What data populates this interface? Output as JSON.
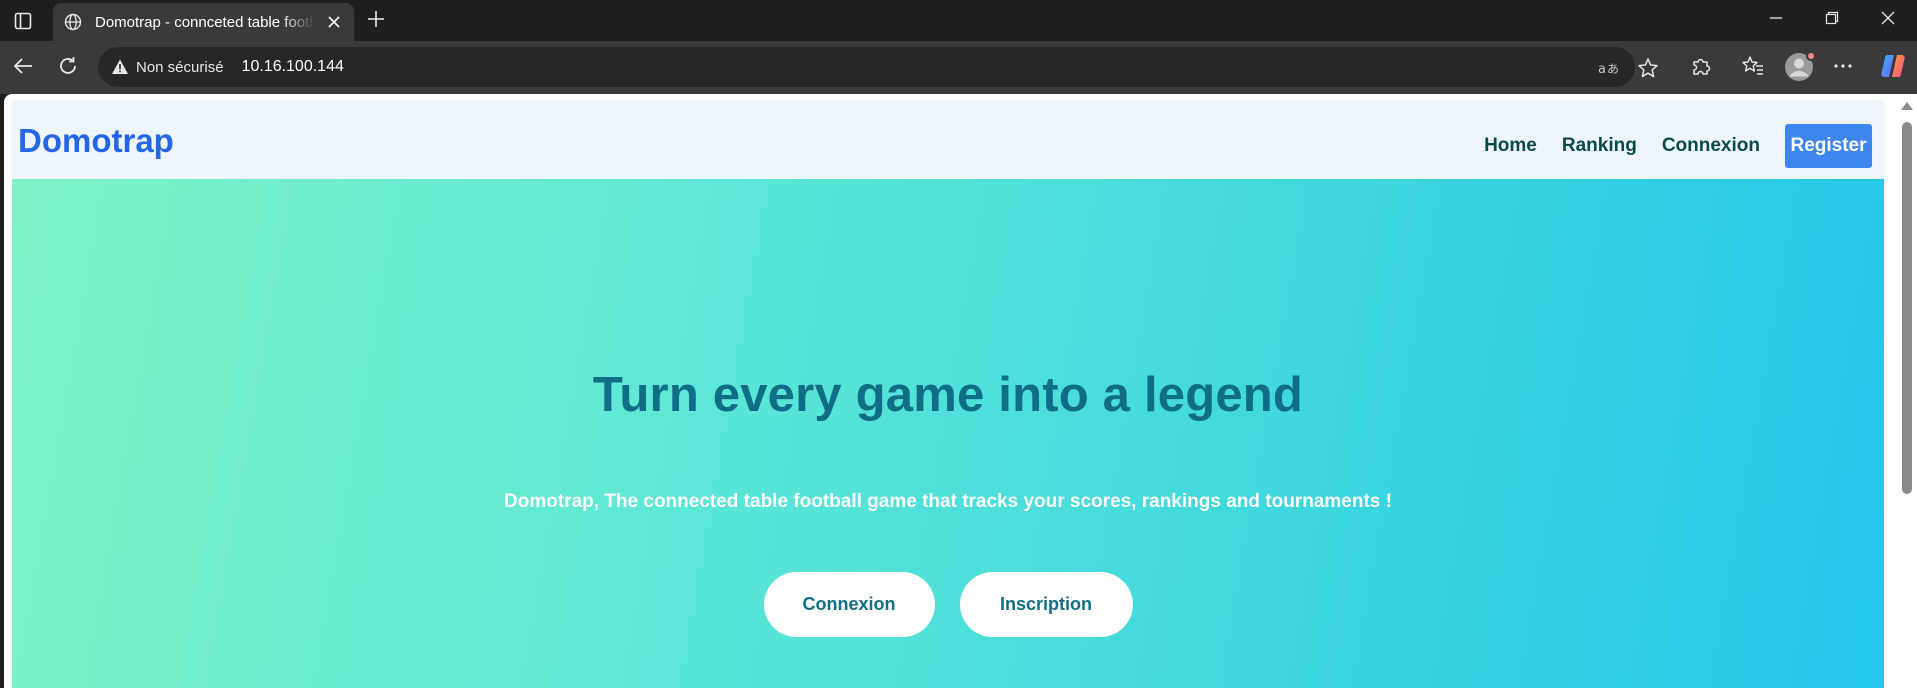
{
  "browser": {
    "tab_title": "Domotrap - connceted table football",
    "security_label": "Non sécurisé",
    "url": "10.16.100.144",
    "icons": {
      "tab_actions": "tab-actions-icon",
      "favicon": "globe-icon",
      "tab_close": "close-icon",
      "new_tab": "plus-icon",
      "minimize": "minimize-icon",
      "restore": "restore-icon",
      "close_window": "close-icon",
      "back": "back-arrow-icon",
      "reload": "reload-icon",
      "warning": "warning-icon",
      "translate": "translate-icon",
      "favorite": "star-icon",
      "extensions": "puzzle-icon",
      "favorites_list": "favorites-icon",
      "profile": "avatar-icon",
      "more": "more-icon",
      "copilot": "copilot-icon"
    }
  },
  "site": {
    "logo": "Domotrap",
    "nav": {
      "home": "Home",
      "ranking": "Ranking",
      "login": "Connexion",
      "register": "Register"
    },
    "hero": {
      "title": "Turn every game into a legend",
      "subtitle": "Domotrap, The connected table football game that tracks your scores, rankings and tournaments !",
      "login_button": "Connexion",
      "signup_button": "Inscription"
    }
  },
  "colors": {
    "brand": "#2566e8",
    "nav_background": "#eef6fc",
    "register_button": "#3d86f0",
    "hero_gradient_start": "#7ff3c7",
    "hero_gradient_end": "#23c7ea",
    "hero_title": "#0f6e86"
  }
}
